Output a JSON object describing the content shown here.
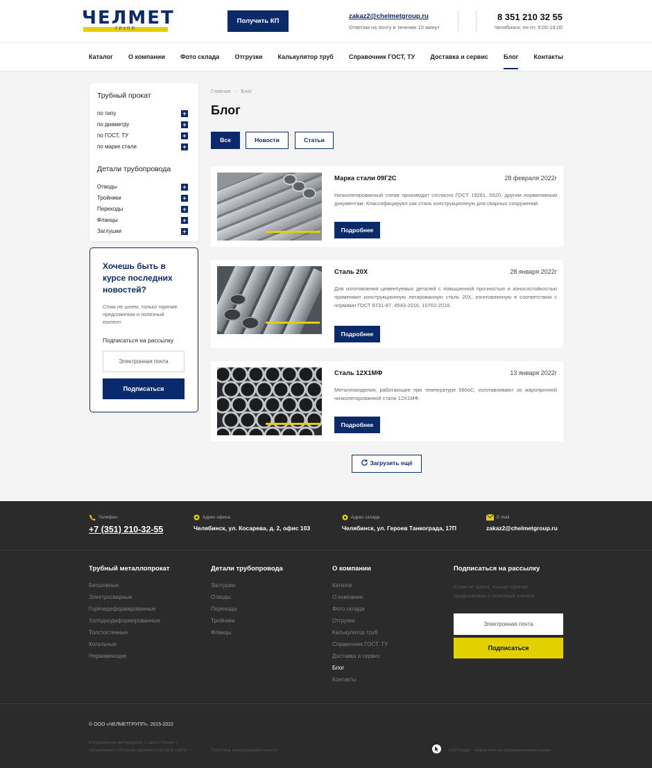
{
  "header": {
    "logo_text": "ЧЕЛМЕТ",
    "logo_sub": "ГРУПП",
    "kp_button": "Получить КП",
    "email": "zakaz2@chelmetgroup.ru",
    "email_sub": "Ответим на почту в течение 15 минут",
    "phone": "8 351 210 32 55",
    "phone_sub": "Челябинск: пн-пт, 9:00-18:00"
  },
  "nav": [
    "Каталог",
    "О компании",
    "Фото склада",
    "Отгрузки",
    "Калькулятор труб",
    "Справочник ГОСТ, ТУ",
    "Доставка и сервис",
    "Блог",
    "Контакты"
  ],
  "sidebar": {
    "pipes_title": "Трубный прокат",
    "pipes_items": [
      "по типу",
      "по диаметру",
      "по ГОСТ, ТУ",
      "по марке стали"
    ],
    "parts_title": "Детали трубопровода",
    "parts_items": [
      "Отводы",
      "Тройники",
      "Переходы",
      "Фланцы",
      "Заглушки"
    ],
    "plus": "+"
  },
  "subscribe": {
    "heading": "Хочешь быть в курсе последних новостей?",
    "text": "Спам не шлем, только горячие предложения и полезный контент",
    "label": "Подписаться на рассылку",
    "placeholder": "Электронная почта",
    "button": "Подписаться"
  },
  "breadcrumb": {
    "home": "Главная",
    "sep": "-",
    "current": "Блог"
  },
  "title": "Блог",
  "tabs": [
    "Все",
    "Новости",
    "Статьи"
  ],
  "posts": [
    {
      "title": "Марка стали 09Г2С",
      "date": "28 февраля 2022г",
      "text": "Низколегированный сплав производят согласно ГОСТ 19281, 5520, другим нормативным документам. Классифицируют как сталь конструкционную для сварных сооружений.",
      "button": "Подробнее"
    },
    {
      "title": "Сталь 20Х",
      "date": "28 января 2022г",
      "text": "Для изготовления цементуемых деталей с повышенной прочностью и износостойкостью применяют конструкционную легированную сталь 20Х, изготовленную в соответствии с нормами ГОСТ 8731-87, 4543-2016, 10702-2016.",
      "button": "Подробнее"
    },
    {
      "title": "Сталь 12Х1МФ",
      "date": "13 января 2022г",
      "text": "Металлоизделия, работающие при температуре 580оС, изготавливают из жаропрочной низколегированной стали 12Х1МФ.",
      "button": "Подробнее"
    }
  ],
  "load_more": "Загрузить ещё",
  "footer": {
    "contacts": [
      {
        "label": "Телефон",
        "value": "+7 (351) 210-32-55"
      },
      {
        "label": "Адрес офиса",
        "value": "Челябинск, ул. Косарева, д. 2, офис 103"
      },
      {
        "label": "Адрес склада",
        "value": "Челябинск, ул. Героев Танкограда, 17П"
      },
      {
        "label": "E-mail",
        "value": "zakaz2@chelmetgroup.ru"
      }
    ],
    "col1": {
      "title": "Трубный металлопрокат",
      "items": [
        "Бесшовные",
        "Электросварные",
        "Горячедеформированные",
        "Холоднодеформированные",
        "Толстостенные",
        "Котельные",
        "Нержавеющие"
      ]
    },
    "col2": {
      "title": "Детали трубопровода",
      "items": [
        "Заглушки",
        "Отводы",
        "Переходы",
        "Тройники",
        "Фланцы"
      ]
    },
    "col3": {
      "title": "О компании",
      "items": [
        "Каталог",
        "О компании",
        "Фото склада",
        "Отгрузки",
        "Калькулятор труб",
        "Справочник ГОСТ, ТУ",
        "Доставка и сервис",
        "Блог",
        "Контакты"
      ]
    },
    "subscribe_title": "Подписаться на рассылку",
    "subscribe_text": "Спам не шлем, только горячие предложения и полезный контент",
    "subscribe_placeholder": "Электронная почта",
    "subscribe_button": "Подписаться",
    "copyright": "© ООО «ЧЕЛМЕТГРУПП», 2015-2022",
    "copy_note": "Копирование материалов с сайта только с письменного согласия администраторов сайта",
    "privacy": "Политика конфиденциальности",
    "developer": "Сайткрафт - маркетинг на промышленном рынке"
  },
  "colors": {
    "brand": "#0a2a6b",
    "accent": "#e3d000",
    "footer_bg": "#2b2b2b",
    "page_bg": "#f4f4f4"
  }
}
